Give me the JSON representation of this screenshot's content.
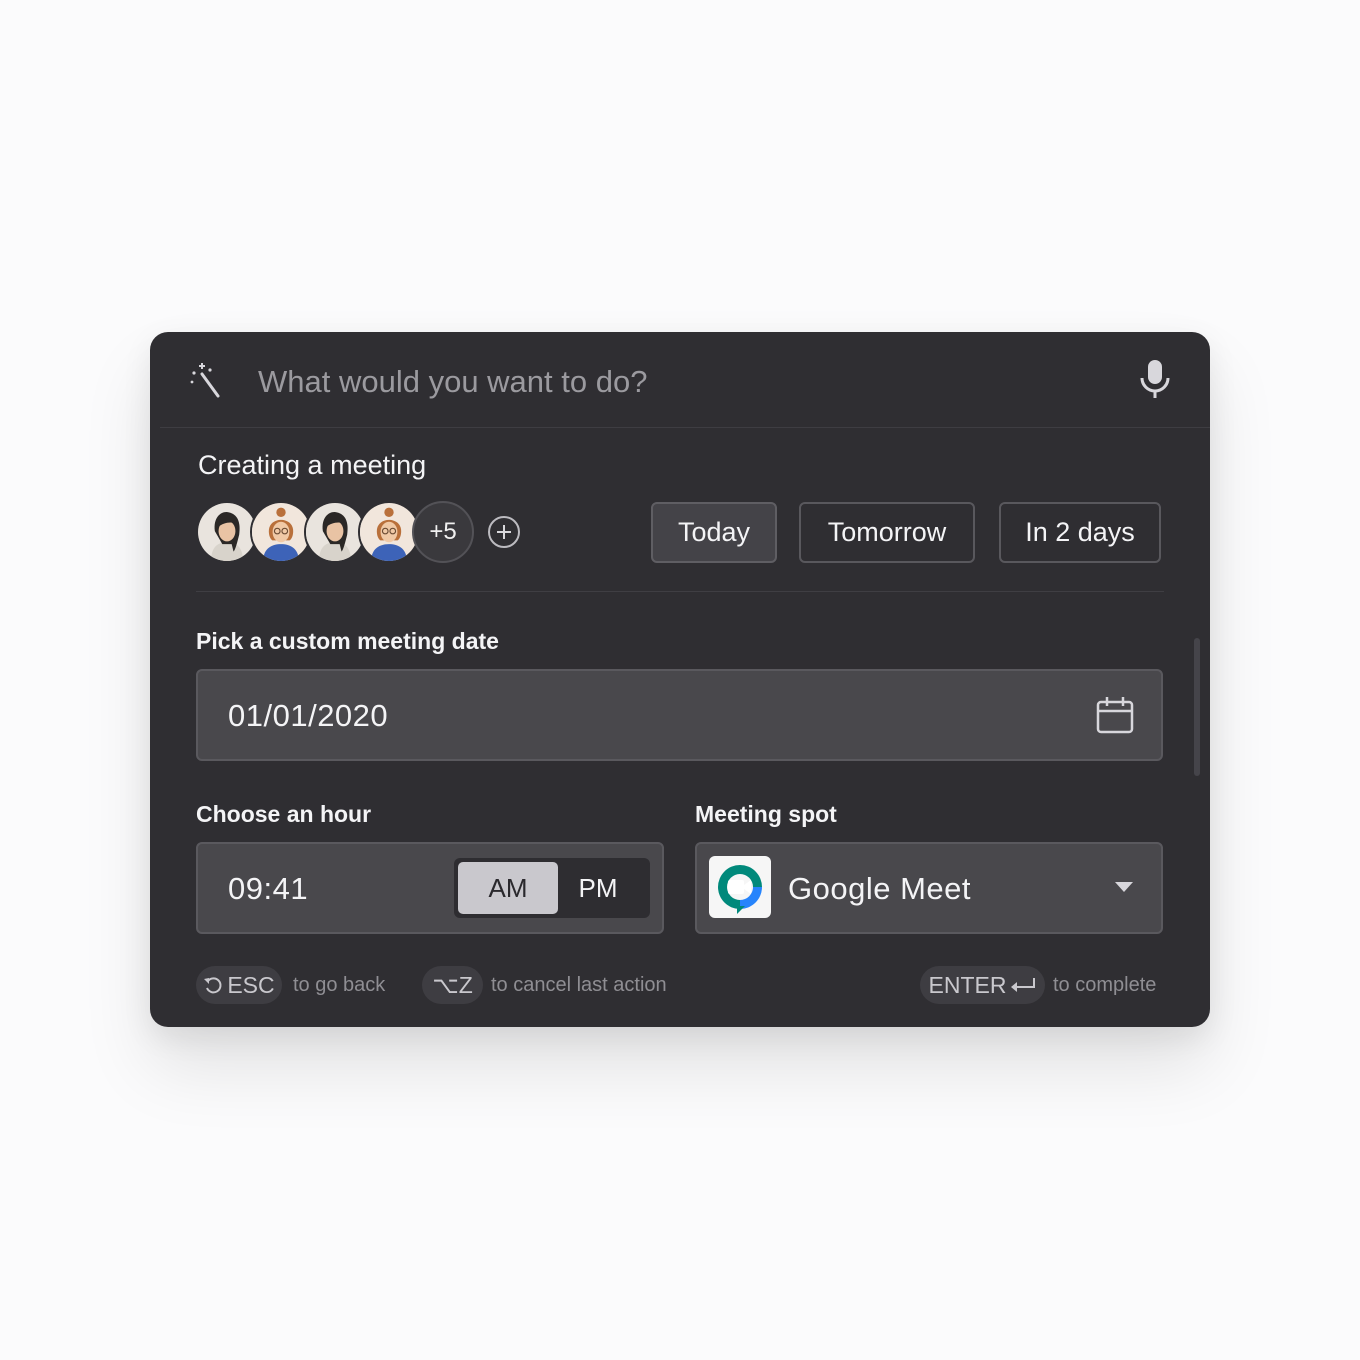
{
  "search": {
    "placeholder": "What would you want to do?"
  },
  "meeting": {
    "title": "Creating a meeting",
    "extra_participants": "+5",
    "quick_dates": [
      "Today",
      "Tomorrow",
      "In 2 days"
    ],
    "selected_quick_date": "Today"
  },
  "date": {
    "label": "Pick a custom meeting date",
    "value": "01/01/2020"
  },
  "hour": {
    "label": "Choose an hour",
    "value": "09:41",
    "am_label": "AM",
    "pm_label": "PM",
    "selected": "AM"
  },
  "spot": {
    "label": "Meeting spot",
    "value": "Google Meet"
  },
  "footer": {
    "esc_key": "ESC",
    "esc_hint": "to go back",
    "undo_key": "⌥Z",
    "undo_hint": "to cancel last action",
    "enter_key": "ENTER",
    "enter_hint": "to complete"
  },
  "icons": [
    "magic-wand-icon",
    "microphone-icon",
    "plus-icon",
    "calendar-icon",
    "google-meet-icon",
    "chevron-down-icon",
    "undo-icon",
    "return-icon"
  ],
  "colors": {
    "panel_bg": "#2f2e32",
    "field_bg": "#49484c",
    "selected_am": "#c9c8cd",
    "meet_green": "#00897b",
    "meet_blue": "#2684fc"
  }
}
